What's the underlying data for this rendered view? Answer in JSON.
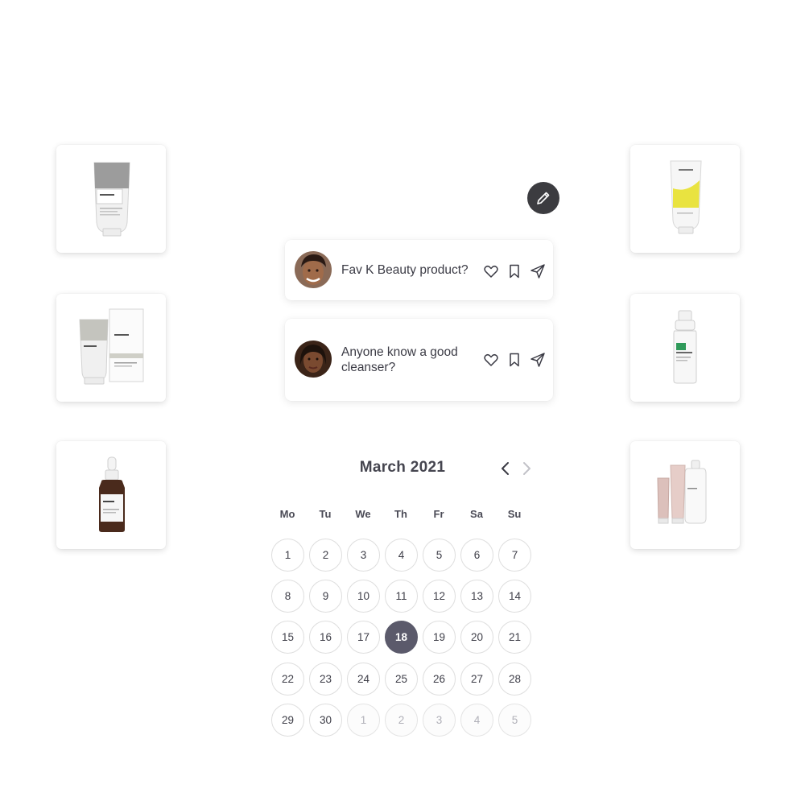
{
  "products": [
    {
      "id": "l1",
      "icon": "white-cream-tube-icon"
    },
    {
      "id": "l2",
      "icon": "cream-tube-with-box-icon"
    },
    {
      "id": "l3",
      "icon": "dropper-serum-bottle-icon"
    },
    {
      "id": "r1",
      "icon": "yellow-label-tube-icon"
    },
    {
      "id": "r2",
      "icon": "foaming-pump-bottle-icon"
    },
    {
      "id": "r3",
      "icon": "pink-tubes-and-bottle-set-icon"
    }
  ],
  "fab": {
    "icon": "pencil-icon"
  },
  "posts": [
    {
      "text": "Fav K Beauty product?"
    },
    {
      "text": "Anyone know a good cleanser?"
    }
  ],
  "calendar": {
    "title": "March 2021",
    "weekdays": [
      "Mo",
      "Tu",
      "We",
      "Th",
      "Fr",
      "Sa",
      "Su"
    ],
    "days": [
      {
        "label": "1",
        "muted": false
      },
      {
        "label": "2",
        "muted": false
      },
      {
        "label": "3",
        "muted": false
      },
      {
        "label": "4",
        "muted": false
      },
      {
        "label": "5",
        "muted": false
      },
      {
        "label": "6",
        "muted": false
      },
      {
        "label": "7",
        "muted": false
      },
      {
        "label": "8",
        "muted": false
      },
      {
        "label": "9",
        "muted": false
      },
      {
        "label": "10",
        "muted": false
      },
      {
        "label": "11",
        "muted": false
      },
      {
        "label": "12",
        "muted": false
      },
      {
        "label": "13",
        "muted": false
      },
      {
        "label": "14",
        "muted": false
      },
      {
        "label": "15",
        "muted": false
      },
      {
        "label": "16",
        "muted": false
      },
      {
        "label": "17",
        "muted": false
      },
      {
        "label": "18",
        "muted": false,
        "selected": true
      },
      {
        "label": "19",
        "muted": false
      },
      {
        "label": "20",
        "muted": false
      },
      {
        "label": "21",
        "muted": false
      },
      {
        "label": "22",
        "muted": false
      },
      {
        "label": "23",
        "muted": false
      },
      {
        "label": "24",
        "muted": false
      },
      {
        "label": "25",
        "muted": false
      },
      {
        "label": "26",
        "muted": false
      },
      {
        "label": "27",
        "muted": false
      },
      {
        "label": "28",
        "muted": false
      },
      {
        "label": "29",
        "muted": false
      },
      {
        "label": "30",
        "muted": false
      },
      {
        "label": "1",
        "muted": true
      },
      {
        "label": "2",
        "muted": true
      },
      {
        "label": "3",
        "muted": true
      },
      {
        "label": "4",
        "muted": true
      },
      {
        "label": "5",
        "muted": true
      }
    ],
    "selected_color": "#5b5a6b"
  }
}
